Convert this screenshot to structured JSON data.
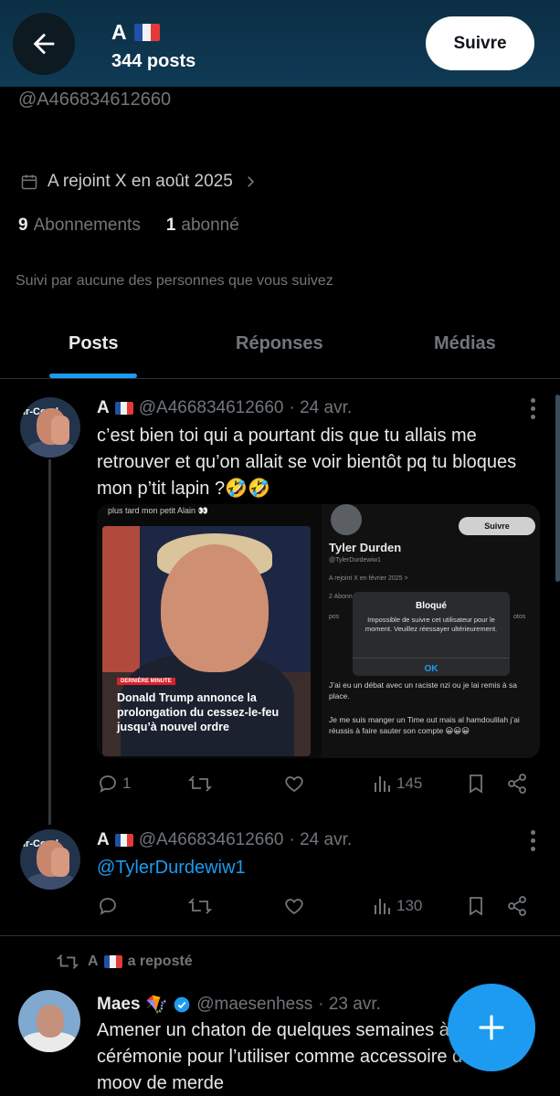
{
  "header": {
    "name": "A",
    "posts_count": "344 posts",
    "follow_label": "Suivre"
  },
  "profile": {
    "handle": "@A466834612660",
    "joined": "A rejoint X en août 2025",
    "following_count": "9",
    "following_label": "Abonnements",
    "followers_count": "1",
    "followers_label": "abonné",
    "mutual": "Suivi par aucune des personnes que vous suivez"
  },
  "tabs": [
    {
      "label": "Posts",
      "active": true
    },
    {
      "label": "Réponses",
      "active": false
    },
    {
      "label": "Médias",
      "active": false
    }
  ],
  "posts": [
    {
      "name": "A",
      "handle": "@A466834612660",
      "date": "· 24 avr.",
      "text": "c’est bien toi qui a pourtant dis que tu allais me retrouver et qu’on allait se voir bientôt pq tu bloques mon p’tit lapin ?🤣🤣",
      "replies": "1",
      "retweets": "",
      "likes": "",
      "views": "145",
      "media": {
        "caption": "plus tard mon petit Alain 👀",
        "news_tag": "DERNIÈRE MINUTE",
        "news_headline": "Donald Trump annonce la prolongation du cessez-le-feu jusqu’à nouvel ordre",
        "shot_follow": "Suivre",
        "shot_name": "Tyler Durden",
        "shot_handle": "@TylerDurdewiw1",
        "shot_joined": "A rejoint X en février 2025 >",
        "shot_stats": "2 Abonn",
        "shot_tab_left": "pos",
        "shot_tab_right": "otos",
        "dialog_title": "Bloqué",
        "dialog_message": "Impossible de suivre cet utilisateur pour le moment. Veuillez réessayer ultérieurement.",
        "dialog_ok": "OK",
        "shot_text1": "J’ai eu un débat avec un raciste nzi ou je lai remis à sa place.",
        "shot_text2": "Je me suis manger un Time out mais al hamdoulilah j’ai réussis à faire sauter son compte 😀😀😀"
      }
    },
    {
      "name": "A",
      "handle": "@A466834612660",
      "date": "· 24 avr.",
      "text": "@TylerDurdewiw1",
      "replies": "",
      "views": "130"
    }
  ],
  "repost": {
    "label": "A",
    "suffix": "a reposté",
    "name": "Maes",
    "emoji": "🪁",
    "handle": "@maesenhess",
    "date": "· 23 avr.",
    "text": "Amener un chaton de quelques semaines à une cérémonie pour l’utiliser comme accessoire de ce moov de merde"
  },
  "avatar_band": "ir-Coral",
  "colors": {
    "accent": "#1d9bf0",
    "header_bg": "#0f3a55",
    "muted": "#71767b",
    "text": "#e7e9ea"
  },
  "icons": [
    "back-arrow-icon",
    "calendar-icon",
    "chevron-right-icon",
    "more-icon",
    "reply-icon",
    "retweet-icon",
    "like-icon",
    "views-icon",
    "bookmark-icon",
    "share-icon",
    "verified-icon",
    "compose-plus-icon"
  ]
}
